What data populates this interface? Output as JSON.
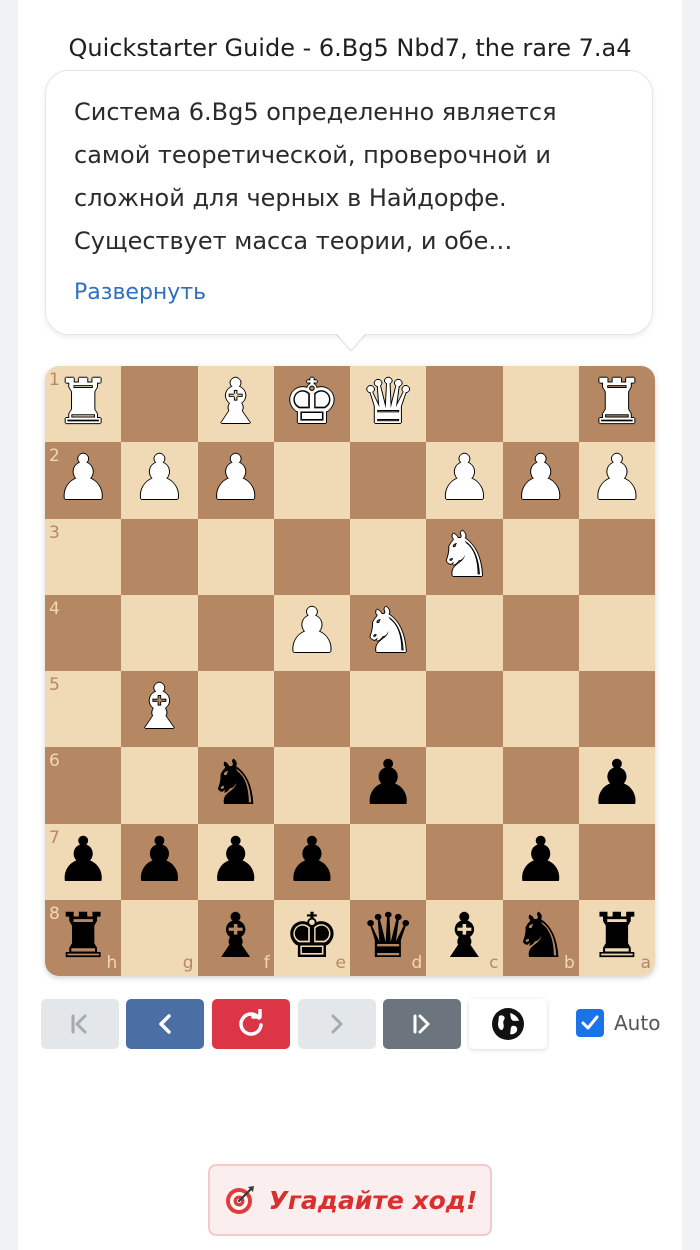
{
  "guide": {
    "title": "Quickstarter Guide - 6.Bg5 Nbd7, the rare 7.a4",
    "description": "Система 6.Bg5 определенно является самой теоретической, проверочной и сложной для черных в Найдорфе. Существует масса теории, и обе стороны…",
    "expand_label": "Развернуть"
  },
  "board": {
    "orientation": "black",
    "rank_labels": [
      "1",
      "2",
      "3",
      "4",
      "5",
      "6",
      "7",
      "8"
    ],
    "file_labels": [
      "h",
      "g",
      "f",
      "e",
      "d",
      "c",
      "b",
      "a"
    ],
    "rows": [
      [
        "R",
        "",
        "B",
        "K",
        "Q",
        "",
        "",
        "R"
      ],
      [
        "P",
        "P",
        "P",
        "",
        "",
        "P",
        "P",
        "P"
      ],
      [
        "",
        "",
        "",
        "",
        "",
        "N",
        "",
        ""
      ],
      [
        "",
        "",
        "",
        "P",
        "N",
        "",
        "",
        ""
      ],
      [
        "",
        "B",
        "",
        "",
        "",
        "",
        "",
        ""
      ],
      [
        "",
        "",
        "n",
        "",
        "p",
        "",
        "",
        "p"
      ],
      [
        "p",
        "p",
        "p",
        "p",
        "",
        "",
        "p",
        ""
      ],
      [
        "r",
        "",
        "b",
        "k",
        "q",
        "b",
        "n",
        "r"
      ]
    ]
  },
  "controls": {
    "first_icon": "skip-to-start-icon",
    "prev_icon": "chevron-left-icon",
    "reset_icon": "refresh-icon",
    "next_icon": "chevron-right-icon",
    "last_icon": "skip-to-end-icon",
    "analysis_icon": "globe-icon",
    "auto_label": "Auto",
    "auto_checked": true
  },
  "guess": {
    "icon": "target-icon",
    "label": "Угадайте ход!"
  },
  "colors": {
    "light_square": "#f0d9b5",
    "dark_square": "#b58863",
    "prev_button": "#4a6fa5",
    "reset_button": "#dc3545",
    "last_button": "#6c757d",
    "guess_text": "#d9302f"
  }
}
